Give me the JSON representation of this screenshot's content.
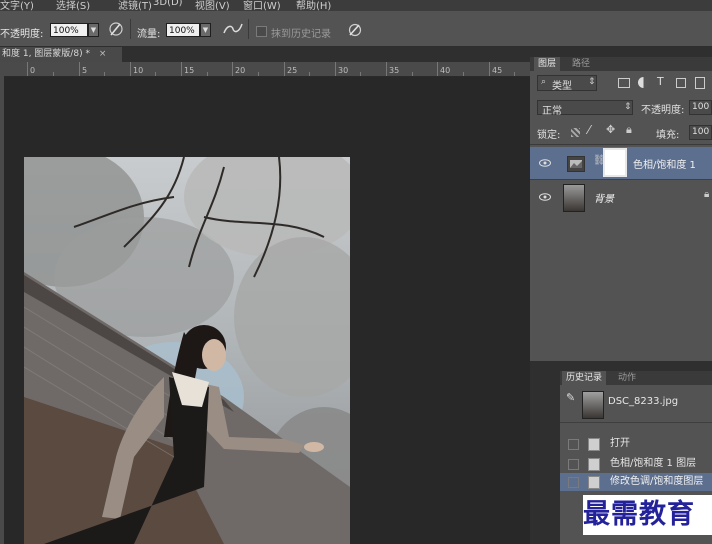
{
  "menu": {
    "items": [
      "文字(Y)",
      "选择(S)",
      "滤镜(T)",
      "3D(D)",
      "视图(V)",
      "窗口(W)",
      "帮助(H)"
    ]
  },
  "options": {
    "opacity_label": "不透明度:",
    "opacity_value": "100%",
    "flow_label": "流量:",
    "flow_value": "100%",
    "history_paint_label": "抹到历史记录"
  },
  "document": {
    "tab_title": "和度 1, 图层蒙版/8) *",
    "close_glyph": "×"
  },
  "ruler": {
    "labels": [
      "0",
      "5",
      "10",
      "15",
      "20",
      "25",
      "30",
      "35",
      "40",
      "45"
    ]
  },
  "layers_panel": {
    "tabs": [
      "图层",
      "路径"
    ],
    "filter_kind": "类型",
    "blend_mode": "正常",
    "opacity_label": "不透明度:",
    "opacity_value": "100",
    "lock_label": "锁定:",
    "fill_label": "填充:",
    "fill_value": "100",
    "layers": [
      {
        "name": "色相/饱和度 1",
        "selected": true
      },
      {
        "name": "背景",
        "selected": false
      }
    ]
  },
  "history_panel": {
    "tabs": [
      "历史记录",
      "动作"
    ],
    "snapshot_name": "DSC_8233.jpg",
    "states": [
      {
        "label": "打开",
        "selected": false
      },
      {
        "label": "色相/饱和度 1 图层",
        "selected": false
      },
      {
        "label": "修改色调/饱和度图层",
        "selected": true
      }
    ]
  },
  "watermark": "最需教育",
  "colors": {
    "selected_row": "#5d6f8f",
    "panel_bg": "#535353",
    "canvas_bg": "#282828"
  }
}
